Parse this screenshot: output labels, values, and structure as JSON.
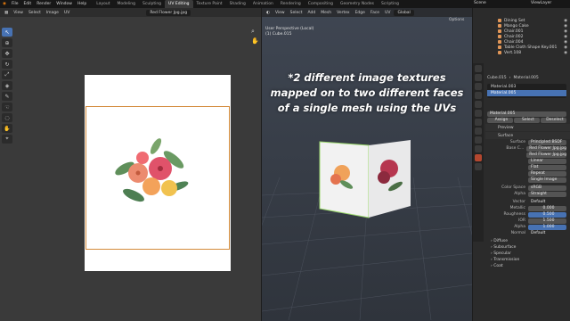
{
  "topbar": {
    "menus": [
      "File",
      "Edit",
      "Render",
      "Window",
      "Help"
    ],
    "workspaces": [
      "Layout",
      "Modeling",
      "Sculpting",
      "UV Editing",
      "Texture Paint",
      "Shading",
      "Animation",
      "Rendering",
      "Compositing",
      "Geometry Nodes",
      "Scripting"
    ],
    "active_workspace": "UV Editing",
    "scene": "Scene",
    "view_layer": "ViewLayer"
  },
  "uv_editor": {
    "menus": [
      "View",
      "Select",
      "Image",
      "UV"
    ],
    "image_name": "Red Flower Jpg.jpg"
  },
  "viewport": {
    "menus": [
      "View",
      "Select",
      "Add",
      "Mesh",
      "Vertex",
      "Edge",
      "Face",
      "UV"
    ],
    "orientation": "Global",
    "options_label": "Options",
    "info_line1": "User Perspective (Local)",
    "info_line2": "(1) Cube.015",
    "caption_line1": "*2 different image textures",
    "caption_line2": "mapped on to two different faces",
    "caption_line3": "of a single mesh using the UVs"
  },
  "outliner": {
    "items": [
      "Dining Set",
      "Mango Cake",
      "Chair.001",
      "Chair.002",
      "Chair.004",
      "Table Cloth Shape Key.001",
      "Vert.108"
    ]
  },
  "properties": {
    "object": "Cube.015",
    "material": "Material.005",
    "material_slots": [
      "Material.003",
      "Material.005"
    ],
    "material_field": "Material.005",
    "tabs": [
      "Assign",
      "Select",
      "Deselect"
    ],
    "preview_label": "Preview",
    "surface_label": "Surface",
    "surface_value": "Principled BSDF",
    "base_color_label": "Base C...",
    "base_color_value": "Red Flower Jpg.jpg",
    "image_field": "Red Flower Jpg.jpg",
    "interpolation": "Linear",
    "projection": "Flat",
    "extension": "Repeat",
    "source": "Single Image",
    "color_space_label": "Color Space",
    "color_space": "sRGB",
    "alpha_label": "Alpha",
    "alpha_value": "Straight",
    "vector_label": "Vector",
    "vector_value": "Default",
    "metallic_label": "Metallic",
    "metallic": "0.000",
    "roughness_label": "Roughness",
    "roughness": "0.500",
    "ior_label": "IOR",
    "ior": "1.500",
    "alpha2_label": "Alpha",
    "alpha2": "1.000",
    "normal_label": "Normal",
    "normal_value": "Default",
    "sections": [
      "Diffuse",
      "Subsurface",
      "Specular",
      "Transmission",
      "Coat"
    ]
  }
}
